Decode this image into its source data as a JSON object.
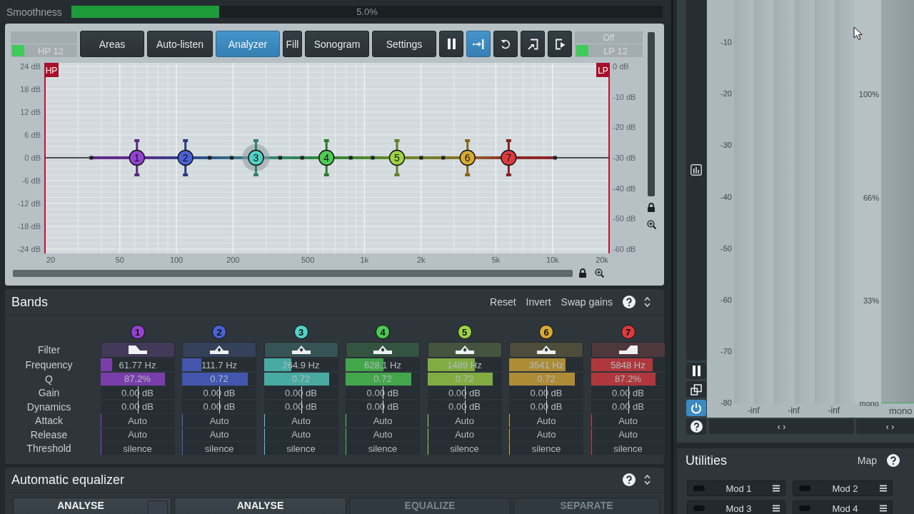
{
  "top_bar": {
    "label": "Smoothness",
    "value": "5.0%",
    "level": 0.25
  },
  "eq": {
    "hp": {
      "label": "HP 12",
      "on": true
    },
    "tabs": [
      {
        "label": "Areas",
        "selected": false
      },
      {
        "label": "Auto-listen",
        "selected": false
      },
      {
        "label": "Analyzer",
        "selected": true
      },
      {
        "label": "Fill",
        "selected": false
      },
      {
        "label": "Sonogram",
        "selected": false
      },
      {
        "label": "Settings",
        "selected": false
      }
    ],
    "tools": [
      {
        "kind": "pause",
        "selected": false
      },
      {
        "kind": "snap",
        "selected": true
      },
      {
        "kind": "undo",
        "selected": false
      },
      {
        "kind": "load",
        "selected": false
      },
      {
        "kind": "save",
        "selected": false
      }
    ],
    "lp": {
      "mode": "Off",
      "label": "LP 12",
      "on": true
    },
    "graph": {
      "hp_tag": "HP",
      "lp_tag": "LP",
      "gain_scale": [
        "24 dB",
        "18 dB",
        "12 dB",
        "6 dB",
        "0 dB",
        "-6 dB",
        "-12 dB",
        "-18 dB",
        "-24 dB"
      ],
      "analyzer_scale": [
        "0 dB",
        "-10 dB",
        "-20 dB",
        "-30 dB",
        "-40 dB",
        "-50 dB",
        "-60 dB"
      ],
      "frequency_scale": [
        "20",
        "50",
        "100",
        "200",
        "500",
        "1k",
        "2k",
        "5k",
        "10k",
        "20k"
      ],
      "nodes": [
        {
          "label": "1",
          "color": "#9442d2",
          "selected": false,
          "level": 0.163
        },
        {
          "label": "2",
          "color": "#4a62d6",
          "selected": false,
          "level": 0.249
        },
        {
          "label": "3",
          "color": "#52d2c6",
          "selected": true,
          "level": 0.374
        },
        {
          "label": "4",
          "color": "#4ccc52",
          "selected": false,
          "level": 0.499
        },
        {
          "label": "5",
          "color": "#9ed444",
          "selected": false,
          "level": 0.624
        },
        {
          "label": "6",
          "color": "#d8aa34",
          "selected": false,
          "level": 0.749
        },
        {
          "label": "7",
          "color": "#dc3a3e",
          "selected": false,
          "level": 0.822
        }
      ]
    }
  },
  "bands": {
    "title": "Bands",
    "actions": [
      "Reset",
      "Invert",
      "Swap gains"
    ],
    "rows": [
      {
        "label": "Filter",
        "kind": "filter"
      },
      {
        "label": "Frequency",
        "kind": "fill"
      },
      {
        "label": "Q",
        "kind": "fill"
      },
      {
        "label": "Gain",
        "kind": "center"
      },
      {
        "label": "Dynamics",
        "kind": "center"
      },
      {
        "label": "Attack",
        "kind": "edge"
      },
      {
        "label": "Release",
        "kind": "edge"
      },
      {
        "label": "Threshold",
        "kind": "edge"
      }
    ],
    "columns": [
      {
        "number": "1",
        "color": "#9442d2",
        "kind": "low_shelf",
        "cells": [
          {
            "text": "61.77 Hz",
            "level": 0.16
          },
          {
            "text": "87.2%",
            "level": 0.87
          },
          {
            "text": "0.00 dB",
            "level": 0.5
          },
          {
            "text": "0.00 dB",
            "level": 0.5
          },
          {
            "text": "Auto",
            "level": 0
          },
          {
            "text": "Auto",
            "level": 0
          },
          {
            "text": "silence",
            "level": 0
          }
        ]
      },
      {
        "number": "2",
        "color": "#4a62d6",
        "kind": "bell",
        "cells": [
          {
            "text": "111.7 Hz",
            "level": 0.26
          },
          {
            "text": "0.72",
            "level": 0.88
          },
          {
            "text": "0.00 dB",
            "level": 0.5
          },
          {
            "text": "0.00 dB",
            "level": 0.5
          },
          {
            "text": "Auto",
            "level": 0
          },
          {
            "text": "Auto",
            "level": 0
          },
          {
            "text": "silence",
            "level": 0
          }
        ]
      },
      {
        "number": "3",
        "color": "#52d2c6",
        "kind": "bell",
        "cells": [
          {
            "text": "264.9 Hz",
            "level": 0.37
          },
          {
            "text": "0.72",
            "level": 0.88
          },
          {
            "text": "0.00 dB",
            "level": 0.5
          },
          {
            "text": "0.00 dB",
            "level": 0.5
          },
          {
            "text": "Auto",
            "level": 0
          },
          {
            "text": "Auto",
            "level": 0
          },
          {
            "text": "silence",
            "level": 0
          }
        ]
      },
      {
        "number": "4",
        "color": "#4ccc52",
        "kind": "bell",
        "cells": [
          {
            "text": "628.1 Hz",
            "level": 0.51
          },
          {
            "text": "0.72",
            "level": 0.88
          },
          {
            "text": "0.00 dB",
            "level": 0.5
          },
          {
            "text": "0.00 dB",
            "level": 0.5
          },
          {
            "text": "Auto",
            "level": 0
          },
          {
            "text": "Auto",
            "level": 0
          },
          {
            "text": "silence",
            "level": 0
          }
        ]
      },
      {
        "number": "5",
        "color": "#9ed444",
        "kind": "bell",
        "cells": [
          {
            "text": "1489 Hz",
            "level": 0.64
          },
          {
            "text": "0.72",
            "level": 0.88
          },
          {
            "text": "0.00 dB",
            "level": 0.5
          },
          {
            "text": "0.00 dB",
            "level": 0.5
          },
          {
            "text": "Auto",
            "level": 0
          },
          {
            "text": "Auto",
            "level": 0
          },
          {
            "text": "silence",
            "level": 0
          }
        ]
      },
      {
        "number": "6",
        "color": "#d8aa34",
        "kind": "bell",
        "cells": [
          {
            "text": "3541 Hz",
            "level": 0.76
          },
          {
            "text": "0.72",
            "level": 0.88
          },
          {
            "text": "0.00 dB",
            "level": 0.5
          },
          {
            "text": "0.00 dB",
            "level": 0.5
          },
          {
            "text": "Auto",
            "level": 0
          },
          {
            "text": "Auto",
            "level": 0
          },
          {
            "text": "silence",
            "level": 0
          }
        ]
      },
      {
        "number": "7",
        "color": "#dc3a3e",
        "kind": "high_shelf",
        "cells": [
          {
            "text": "5848 Hz",
            "level": 0.83
          },
          {
            "text": "87.2%",
            "level": 0.87
          },
          {
            "text": "0.00 dB",
            "level": 0.5
          },
          {
            "text": "0.00 dB",
            "level": 0.5
          },
          {
            "text": "Auto",
            "level": 0
          },
          {
            "text": "Auto",
            "level": 0
          },
          {
            "text": "silence",
            "level": 0
          }
        ]
      }
    ]
  },
  "auto_eq": {
    "title": "Automatic equalizer",
    "buttons": [
      {
        "label": "ANALYSE",
        "kind": "split",
        "disabled": false
      },
      {
        "label": "ANALYSE",
        "kind": "plain",
        "disabled": false
      },
      {
        "label": "EQUALIZE",
        "kind": "plain",
        "disabled": true
      },
      {
        "label": "SEPARATE",
        "kind": "plain",
        "disabled": true
      }
    ]
  },
  "meters": {
    "scale": [
      "-10",
      "-20",
      "-30",
      "-40",
      "-50",
      "-60",
      "-70",
      "-80"
    ],
    "percent_scale": [
      "100%",
      "66%",
      "33%",
      "mono"
    ],
    "readings": [
      "-inf",
      "-inf",
      "-inf"
    ],
    "side_reading": "mono",
    "tools": [
      {
        "kind": "pause",
        "on": false
      },
      {
        "kind": "resize",
        "on": false
      },
      {
        "kind": "power",
        "on": true
      },
      {
        "kind": "help",
        "on": false
      }
    ],
    "pan_buttons": [
      "‹ ›",
      "‹ ›"
    ]
  },
  "utilities": {
    "title": "Utilities",
    "map": "Map",
    "mods": [
      "Mod 1",
      "Mod 2",
      "Mod 3",
      "Mod 4"
    ]
  }
}
